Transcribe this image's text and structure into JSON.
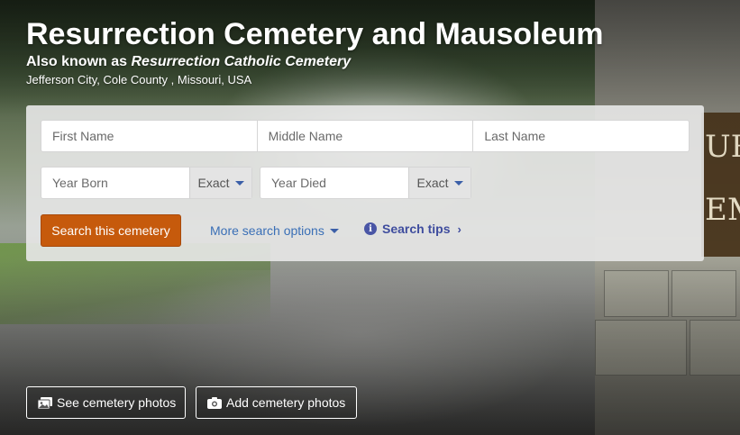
{
  "header": {
    "title": "Resurrection Cemetery and Mausoleum",
    "aka_prefix": "Also known as",
    "aka_name": "Resurrection Catholic Cemetery",
    "location": "Jefferson City, Cole County , Missouri, USA"
  },
  "search": {
    "first_name_placeholder": "First Name",
    "middle_name_placeholder": "Middle Name",
    "last_name_placeholder": "Last Name",
    "year_born_placeholder": "Year Born",
    "year_born_mode": "Exact",
    "year_died_placeholder": "Year Died",
    "year_died_mode": "Exact",
    "search_button": "Search this cemetery",
    "more_options": "More search options",
    "tips": "Search tips"
  },
  "photos": {
    "see_label": "See cemetery photos",
    "add_label": "Add cemetery photos"
  },
  "colors": {
    "search_button": "#c65a0c",
    "link": "#3a6fb6",
    "tips": "#3f4d9e"
  },
  "icons": [
    "photos-icon",
    "camera-icon",
    "info-icon",
    "caret-down-icon",
    "chevron-right-icon"
  ]
}
